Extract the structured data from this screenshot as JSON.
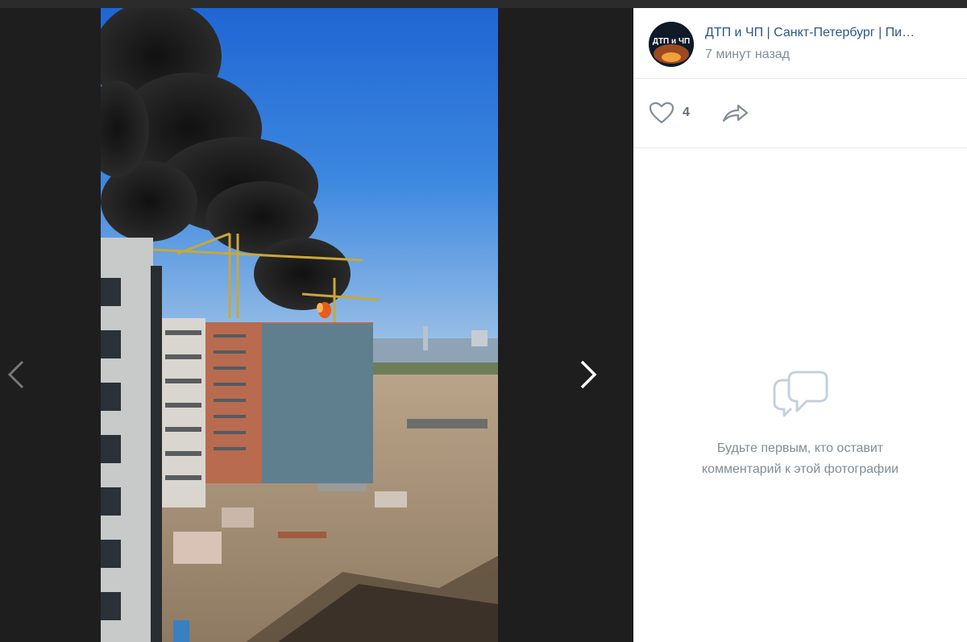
{
  "post": {
    "author": "ДТП и ЧП | Санкт-Петербург | Пи…",
    "time": "7 минут назад",
    "likes": "4"
  },
  "comments": {
    "empty_line1": "Будьте первым, кто оставит",
    "empty_line2": "комментарий к этой фотографии"
  },
  "avatar_text": "ДТП и ЧП",
  "icons": {
    "prev": "chevron-left-icon",
    "next": "chevron-right-icon",
    "like": "heart-icon",
    "share": "share-arrow-icon",
    "comments": "comment-bubbles-icon"
  },
  "colors": {
    "link": "#2a5885",
    "muted": "#818c99",
    "accent": "#c5d0db"
  }
}
